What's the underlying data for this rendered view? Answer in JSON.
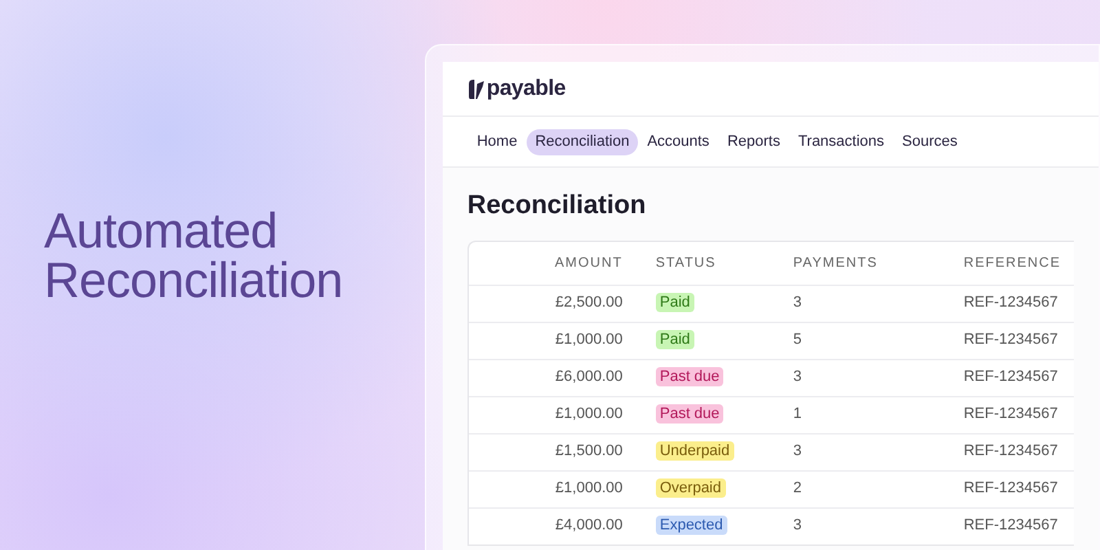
{
  "headline": [
    "Automated",
    "Reconciliation"
  ],
  "app": {
    "logo": "payable",
    "tabs": [
      {
        "label": "Home",
        "selected": false
      },
      {
        "label": "Reconciliation",
        "selected": true
      },
      {
        "label": "Accounts",
        "selected": false
      },
      {
        "label": "Reports",
        "selected": false
      },
      {
        "label": "Transactions",
        "selected": false
      },
      {
        "label": "Sources",
        "selected": false
      }
    ],
    "heading": "Reconciliation",
    "table": {
      "columns": [
        "AMOUNT",
        "STATUS",
        "PAYMENTS",
        "REFERENCE"
      ],
      "rows": [
        {
          "amount": "£2,500.00",
          "status": "Paid",
          "kind": "success",
          "payments": "3",
          "reference": "REF-1234567"
        },
        {
          "amount": "£1,000.00",
          "status": "Paid",
          "kind": "success",
          "payments": "5",
          "reference": "REF-1234567"
        },
        {
          "amount": "£6,000.00",
          "status": "Past due",
          "kind": "danger",
          "payments": "3",
          "reference": "REF-1234567"
        },
        {
          "amount": "£1,000.00",
          "status": "Past due",
          "kind": "danger",
          "payments": "1",
          "reference": "REF-1234567"
        },
        {
          "amount": "£1,500.00",
          "status": "Underpaid",
          "kind": "warning",
          "payments": "3",
          "reference": "REF-1234567"
        },
        {
          "amount": "£1,000.00",
          "status": "Overpaid",
          "kind": "warning",
          "payments": "2",
          "reference": "REF-1234567"
        },
        {
          "amount": "£4,000.00",
          "status": "Expected",
          "kind": "info",
          "payments": "3",
          "reference": "REF-1234567"
        }
      ]
    }
  }
}
